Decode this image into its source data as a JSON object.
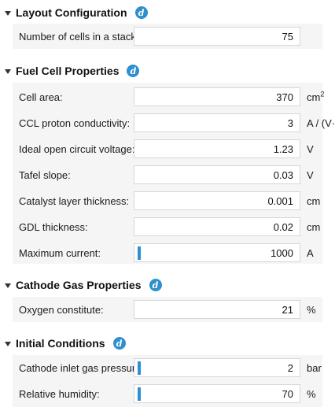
{
  "sections": {
    "layout": {
      "title": "Layout Configuration",
      "info": "d",
      "rows": [
        {
          "label": "Number of cells in a stack:",
          "value": "75",
          "unit": ""
        }
      ]
    },
    "fuel": {
      "title": "Fuel Cell Properties",
      "info": "d",
      "rows": [
        {
          "label": "Cell area:",
          "value": "370",
          "unit": "cm",
          "unit_sup": "2"
        },
        {
          "label": "CCL proton conductivity:",
          "value": "3",
          "unit": "A / (V·m)"
        },
        {
          "label": "Ideal open circuit voltage:",
          "value": "1.23",
          "unit": "V"
        },
        {
          "label": "Tafel slope:",
          "value": "0.03",
          "unit": "V"
        },
        {
          "label": "Catalyst layer thickness:",
          "value": "0.001",
          "unit": "cm"
        },
        {
          "label": "GDL thickness:",
          "value": "0.02",
          "unit": "cm"
        },
        {
          "label": "Maximum current:",
          "value": "1000",
          "unit": "A"
        }
      ]
    },
    "cathode": {
      "title": "Cathode Gas Properties",
      "info": "d",
      "rows": [
        {
          "label": "Oxygen constitute:",
          "value": "21",
          "unit": "%"
        }
      ]
    },
    "initial": {
      "title": "Initial Conditions",
      "info": "d",
      "rows": [
        {
          "label": "Cathode inlet gas pressure:",
          "value": "2",
          "unit": "bar"
        },
        {
          "label": "Relative humidity:",
          "value": "70",
          "unit": "%"
        }
      ]
    }
  },
  "colors": {
    "accent": "#2f8fcf",
    "panel": "#f5f5f5",
    "field_border": "#d6d6d6"
  }
}
